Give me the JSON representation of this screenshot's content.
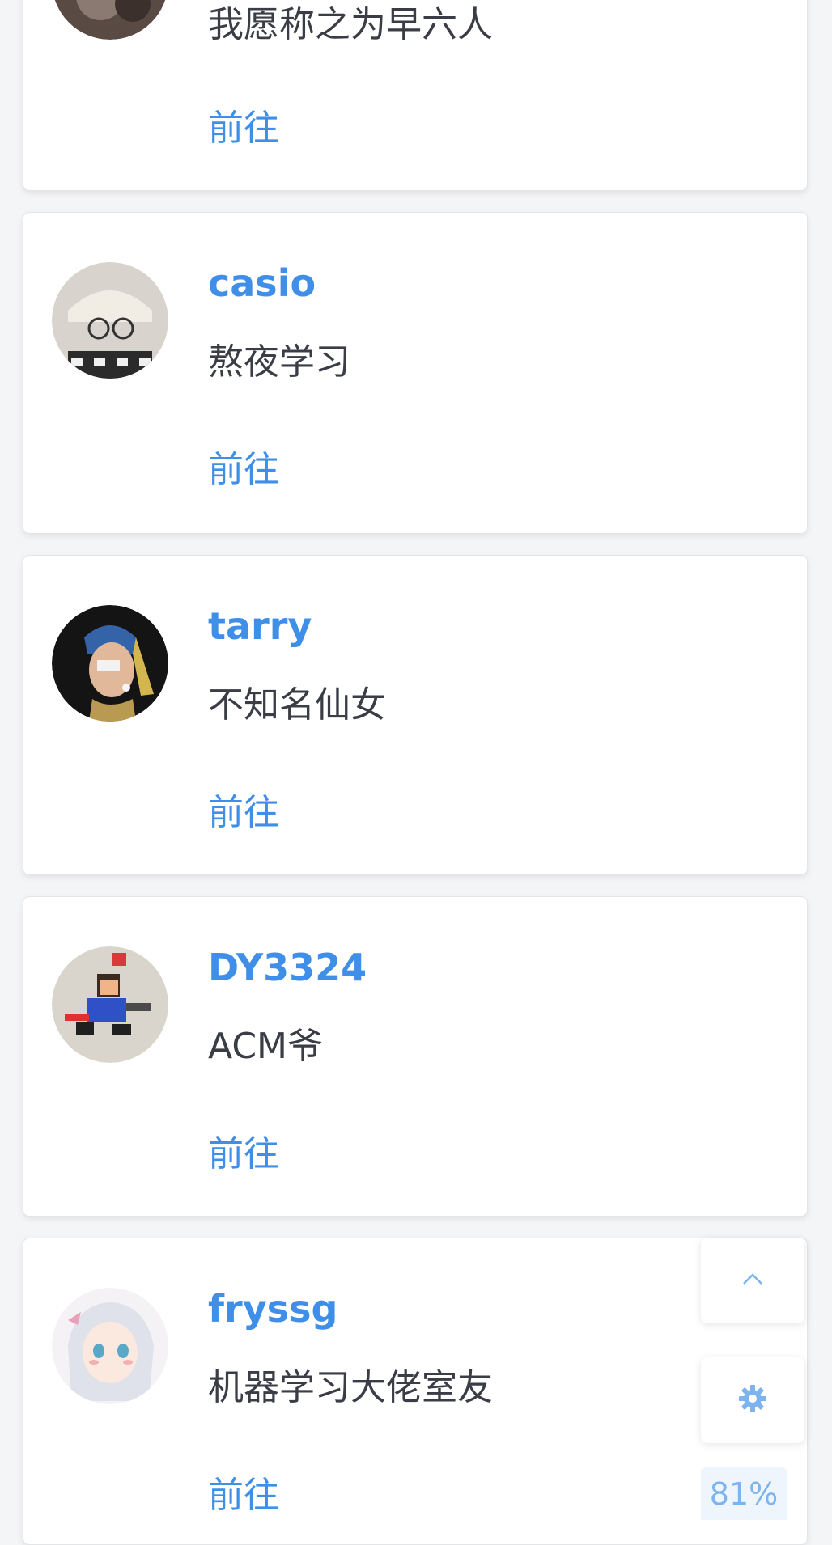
{
  "users": [
    {
      "name": "",
      "desc": "我愿称之为早六人",
      "link": "前往",
      "avatar": "cat-dark-avatar"
    },
    {
      "name": "casio",
      "desc": "熬夜学习",
      "link": "前往",
      "avatar": "cat-glasses-avatar"
    },
    {
      "name": "tarry",
      "desc": "不知名仙女",
      "link": "前往",
      "avatar": "pearl-earring-avatar"
    },
    {
      "name": "DY3324",
      "desc": "ACM爷",
      "link": "前往",
      "avatar": "pixel-runner-avatar"
    },
    {
      "name": "fryssg",
      "desc": "机器学习大佬室友",
      "link": "前往",
      "avatar": "anime-girl-avatar"
    }
  ],
  "floating": {
    "scroll_top_icon": "chevron-up-icon",
    "settings_icon": "gear-icon",
    "progress": "81%"
  },
  "colors": {
    "accent": "#3f8fe8",
    "text": "#3a3d45",
    "background": "#f4f5f7"
  }
}
